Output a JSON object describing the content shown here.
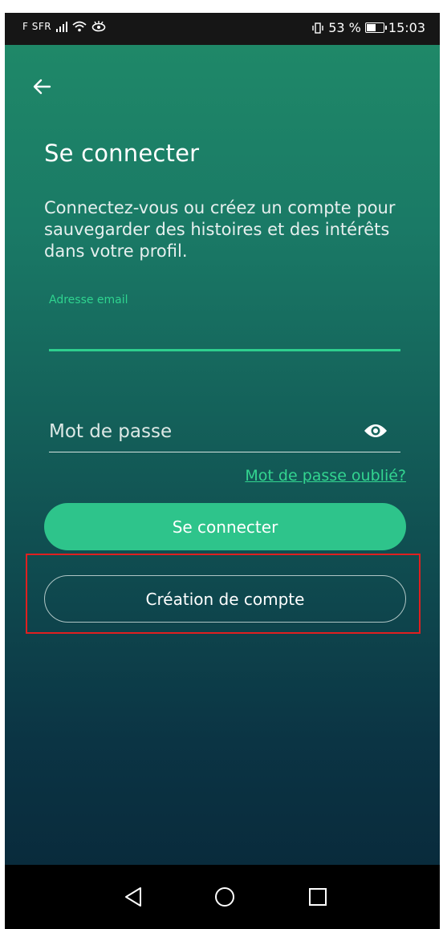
{
  "status_bar": {
    "carrier": "F SFR",
    "battery_text": "53 %",
    "time": "15:03",
    "icons": [
      "signal-icon",
      "wifi-icon",
      "eye-notification-icon",
      "vibrate-icon",
      "battery-icon"
    ]
  },
  "header": {
    "back_icon": "arrow-left-icon"
  },
  "login": {
    "title": "Se connecter",
    "subtitle": "Connectez-vous ou créez un compte pour sauvegarder des histoires et des intérêts dans votre profil.",
    "email_label": "Adresse email",
    "email_value": "",
    "password_placeholder": "Mot de passe",
    "password_value": "",
    "show_password_icon": "eye-icon",
    "forgot_password": "Mot de passe oublié?",
    "login_button": "Se connecter",
    "create_account_button": "Création de compte"
  },
  "nav_bar": {
    "icons": [
      "back-triangle-icon",
      "home-circle-icon",
      "recents-square-icon"
    ]
  },
  "colors": {
    "accent": "#2ec48b",
    "highlight": "#e02020",
    "gradient_top": "#1f8868",
    "gradient_bottom": "#092b3c"
  }
}
